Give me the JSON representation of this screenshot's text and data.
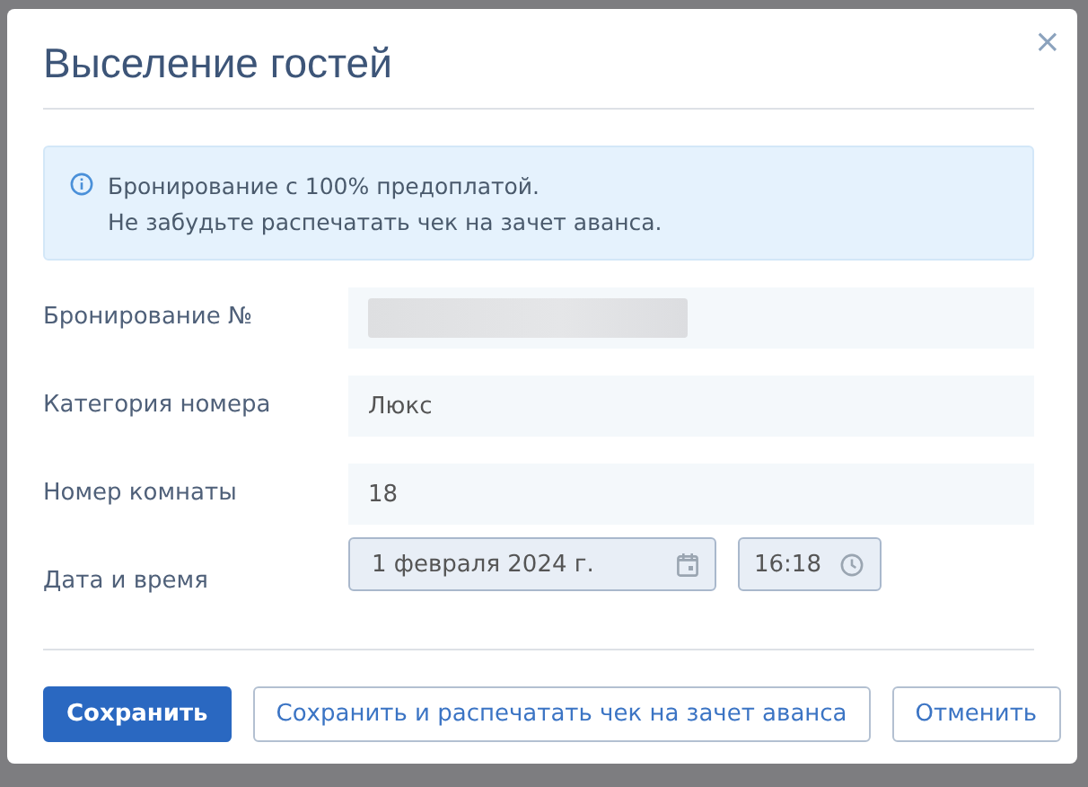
{
  "dialog": {
    "title": "Выселение гостей",
    "close": "×"
  },
  "alert": {
    "lines": [
      "Бронирование с 100% предоплатой.",
      "Не забудьте распечатать чек на зачет аванса."
    ]
  },
  "fields": [
    {
      "label": "Бронирование №",
      "kind": "blurred"
    },
    {
      "label": "Категория номера",
      "kind": "text",
      "value": "Люкс"
    },
    {
      "label": "Номер комнаты",
      "kind": "text",
      "value": "18"
    },
    {
      "label": "Дата и время",
      "kind": "datetime",
      "date": "1 февраля 2024 г.",
      "time": "16:18"
    }
  ],
  "buttons": [
    {
      "label": "Сохранить",
      "kind": "primary"
    },
    {
      "label": "Сохранить и распечатать чек на зачет аванса",
      "kind": "outline"
    },
    {
      "label": "Отменить",
      "kind": "outline"
    }
  ]
}
